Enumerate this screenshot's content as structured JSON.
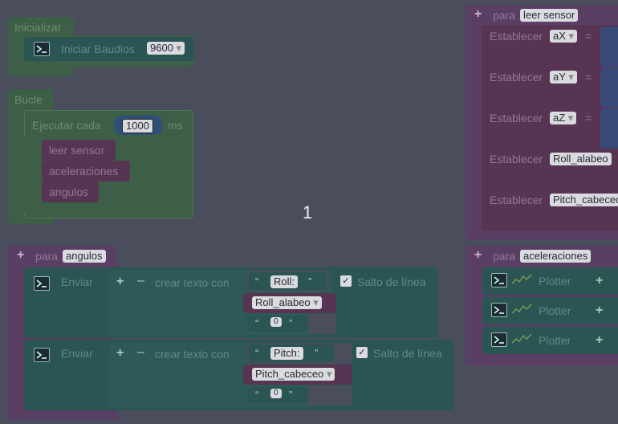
{
  "colors": {
    "background": "#4a4d5b",
    "green_block": "#3d5e47",
    "green_text": "#6f8d70",
    "teal_block": "#2b5553",
    "teal_text": "#5f8a88",
    "purple_block": "#5a3f64",
    "purple_text": "#8f7996",
    "magenta_block": "#573452",
    "field_bg": "#d9dbe0"
  },
  "setup_block": {
    "title": "Inicializar",
    "serial_begin": {
      "label": "Iniciar  Baudios",
      "baud": "9600"
    }
  },
  "loop_block": {
    "title": "Bucle",
    "every_label": "Ejecutar cada",
    "interval": "1000",
    "unit": "ms",
    "calls": [
      "leer sensor",
      "aceleraciones",
      "angulos"
    ]
  },
  "workspace_counter": "1",
  "fn_angulos": {
    "para": "para",
    "name": "angulos",
    "prints": [
      {
        "send": "Enviar",
        "create": "crear texto con",
        "text1": "Roll:",
        "var": "Roll_alabeo",
        "text3": "0",
        "newline": "Salto de línea",
        "checked": "✓"
      },
      {
        "send": "Enviar",
        "create": "crear texto con",
        "text1": "Pitch:",
        "var": "Pitch_cabeceo",
        "text3": "0",
        "newline": "Salto de línea",
        "checked": "✓"
      }
    ]
  },
  "fn_leer_sensor": {
    "para": "para",
    "name": "leer sensor",
    "sets": [
      {
        "label": "Establecer",
        "var": "aX",
        "eq": "="
      },
      {
        "label": "Establecer",
        "var": "aY",
        "eq": "="
      },
      {
        "label": "Establecer",
        "var": "aZ",
        "eq": "="
      },
      {
        "label": "Establecer",
        "var": "Roll_alabeo"
      },
      {
        "label": "Establecer",
        "var": "Pitch_cabeceo"
      }
    ]
  },
  "fn_aceleraciones": {
    "para": "para",
    "name": "aceleraciones",
    "plotters": [
      "Plotter",
      "Plotter",
      "Plotter"
    ]
  },
  "icons": {
    "plus": "+",
    "minus": "–",
    "open_quote": "“",
    "close_quote": "”",
    "dropdown_arrow": "▾"
  }
}
